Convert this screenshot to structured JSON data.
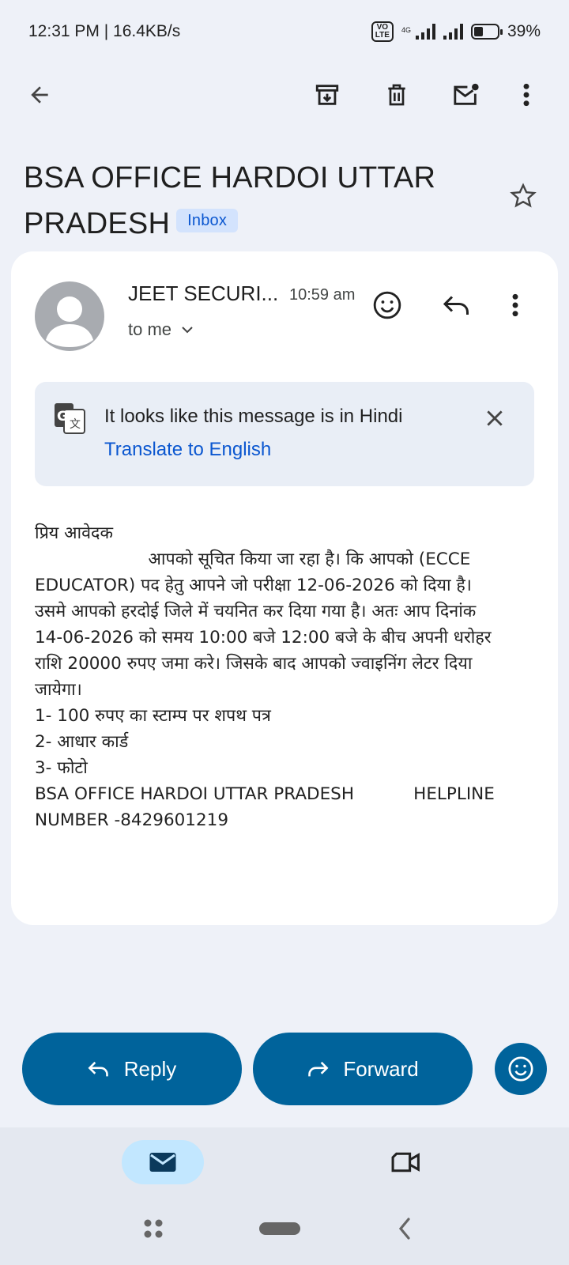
{
  "status_bar": {
    "time_speed": "12:31 PM | 16.4KB/s",
    "volte_line1": "VO",
    "volte_line2": "LTE",
    "network": "4G",
    "battery_percent": "39%",
    "battery_level": 0.39
  },
  "toolbar": {
    "icons": [
      "back-arrow-icon",
      "archive-icon",
      "delete-icon",
      "mark-unread-icon",
      "more-vert-icon"
    ]
  },
  "email": {
    "subject": "BSA OFFICE HARDOI UTTAR PRADESH",
    "label": "Inbox",
    "sender": "JEET SECURI...",
    "time": "10:59 am",
    "recipient": "to me"
  },
  "translate": {
    "message": "It looks like this message is in Hindi",
    "action": "Translate to English"
  },
  "body": {
    "lines": [
      "प्रिय आवेदक",
      "                     आपको सूचित किया जा रहा है। कि आपको (ECCE",
      "EDUCATOR) पद हेतु आपने जो परीक्षा 12-06-2026 को दिया है।",
      "उसमे आपको हरदोई जिले में चयनित कर दिया गया है। अतः आप दिनांक",
      "14-06-2026 को समय 10:00 बजे 12:00 बजे के बीच अपनी धरोहर",
      "राशि 20000 रुपए जमा करे। जिसके बाद आपको ज्वाइनिंग लेटर दिया",
      "जायेगा।",
      "1- 100 रुपए का स्टाम्प पर शपथ पत्र",
      "2- आधार कार्ड",
      "3- फोटो",
      "BSA OFFICE HARDOI UTTAR PRADESH           HELPLINE",
      "NUMBER -8429601219"
    ]
  },
  "actions": {
    "reply": "Reply",
    "forward": "Forward"
  },
  "colors": {
    "accent": "#00639b",
    "link": "#0b57d0",
    "chip_bg": "#d3e3fd",
    "background": "#eef1f8"
  }
}
